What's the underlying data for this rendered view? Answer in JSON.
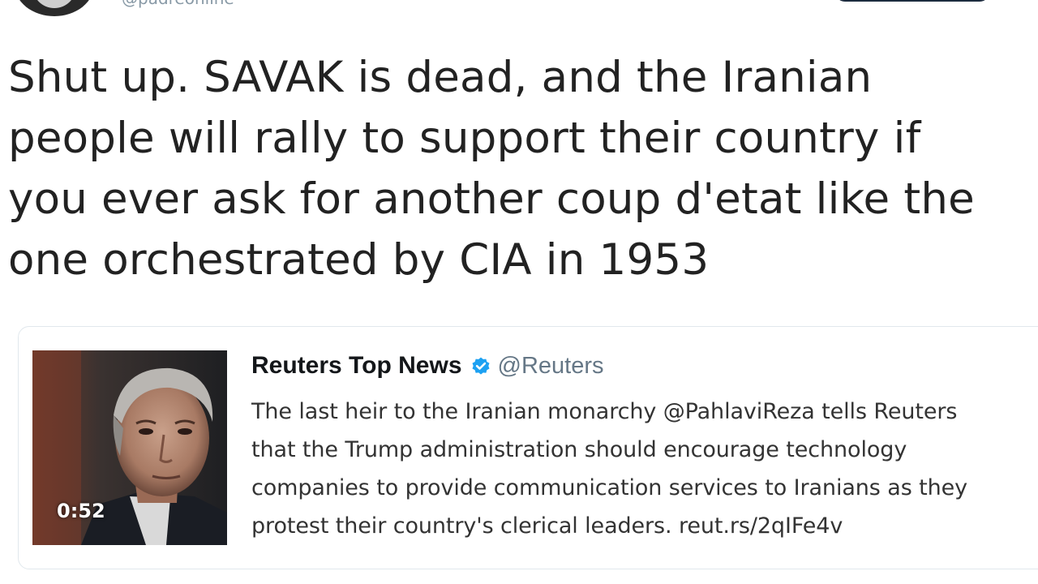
{
  "header": {
    "handle": "@padreonline"
  },
  "tweet": {
    "lines": [
      "Shut up. SAVAK is dead, and the Iranian",
      "people will rally to support their country if",
      "you ever ask for another coup d'etat like the",
      "one orchestrated by CIA in 1953"
    ]
  },
  "quoted_tweet": {
    "name": "Reuters Top News",
    "handle": "@Reuters",
    "verified_icon": "verified-badge-icon",
    "media_duration": "0:52",
    "lines": [
      "The last heir to the Iranian monarchy @PahlaviReza tells Reuters",
      "that the Trump administration should encourage technology",
      "companies to provide communication services to Iranians as they",
      "protest their country's clerical leaders. reut.rs/2qIFe4v"
    ]
  },
  "colors": {
    "verified": "#1da1f2",
    "handle_gray": "#657786",
    "card_border": "#e1e8ed"
  }
}
